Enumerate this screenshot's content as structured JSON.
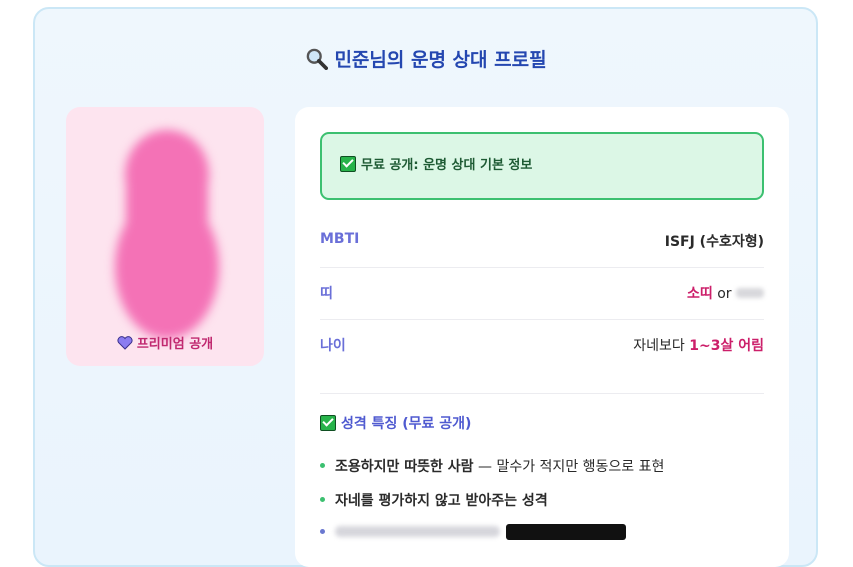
{
  "header": {
    "title": "민준님의 운명 상대 프로필",
    "title_icon": "magnifier-icon"
  },
  "photo_card": {
    "premium_label": "프리미엄 공개",
    "premium_icon": "purple-heart-icon"
  },
  "info_card": {
    "free_notice": "무료 공개: 운명 상대 기본 정보",
    "rows": [
      {
        "label": "MBTI",
        "value": "ISFJ (수호자형)"
      },
      {
        "label": "띠",
        "value_main": "소띠",
        "value_or": "or"
      },
      {
        "label": "나이",
        "value_prefix": "자네보다 ",
        "value_highlight": "1~3살 어림"
      }
    ],
    "traits_title": "성격 특징 (무료 공개)",
    "traits": [
      {
        "bold": "조용하지만 따뜻한 사람",
        "rest": " — 말수가 적지만 행동으로 표현"
      },
      {
        "bold": "자네를 평가하지 않고 받아주는 성격",
        "rest": ""
      }
    ]
  },
  "colors": {
    "accent_blue": "#2447b0",
    "pink": "#cc1f6a",
    "green_border": "#3cc070",
    "label_purple": "#6a6fd8"
  }
}
